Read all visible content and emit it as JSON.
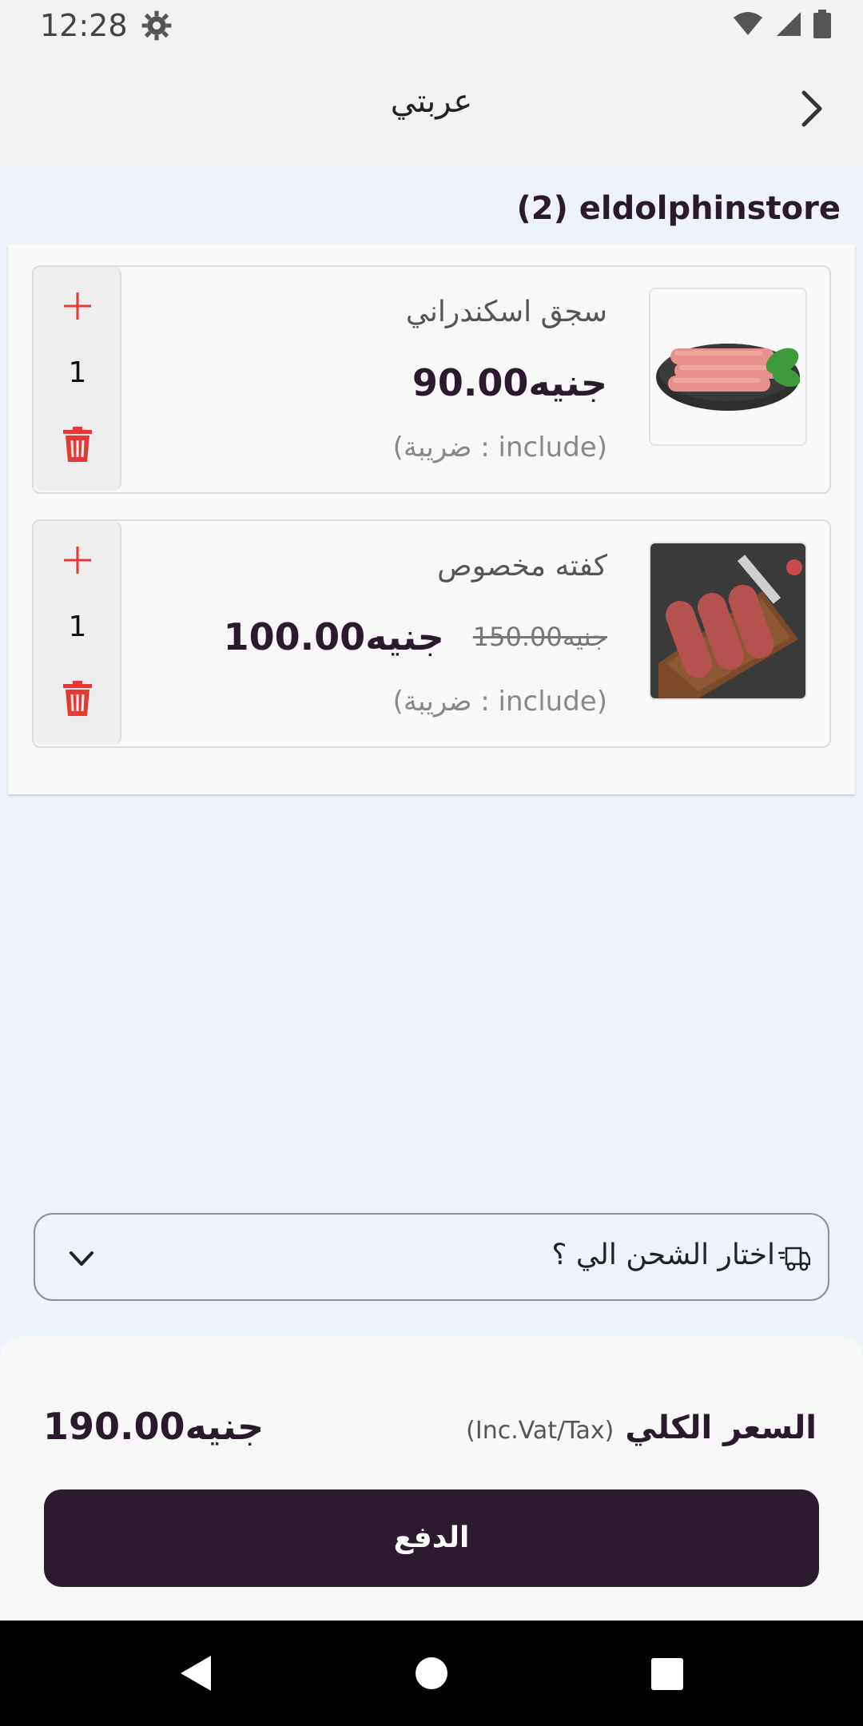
{
  "status_bar": {
    "time": "12:28"
  },
  "app_bar": {
    "title": "عربتي"
  },
  "store": {
    "title": "(2) eldolphinstore"
  },
  "cart_items": [
    {
      "name": "سجق اسكندراني",
      "price": "جنيه90.00",
      "old_price": "",
      "tax_note": "(ضريبة : include)",
      "quantity": "1"
    },
    {
      "name": "كفته مخصوص",
      "price": "جنيه100.00",
      "old_price": "جنيه150.00",
      "tax_note": "(ضريبة : include)",
      "quantity": "1"
    }
  ],
  "shipping": {
    "placeholder": "اختار الشحن الي ؟"
  },
  "summary": {
    "total_label": "السعر الكلي",
    "total_sub": "(Inc.Vat/Tax)",
    "total_value": "جنيه190.00"
  },
  "pay_button": {
    "label": "الدفع"
  },
  "colors": {
    "accent": "#2c1a2e",
    "danger": "#e53935",
    "background": "#eef2fa"
  },
  "icons": [
    "settings-icon",
    "wifi-icon",
    "signal-icon",
    "battery-icon",
    "back-chevron-icon",
    "plus-icon",
    "trash-icon",
    "truck-icon",
    "chevron-down-icon",
    "nav-back-icon",
    "nav-home-icon",
    "nav-recents-icon"
  ]
}
